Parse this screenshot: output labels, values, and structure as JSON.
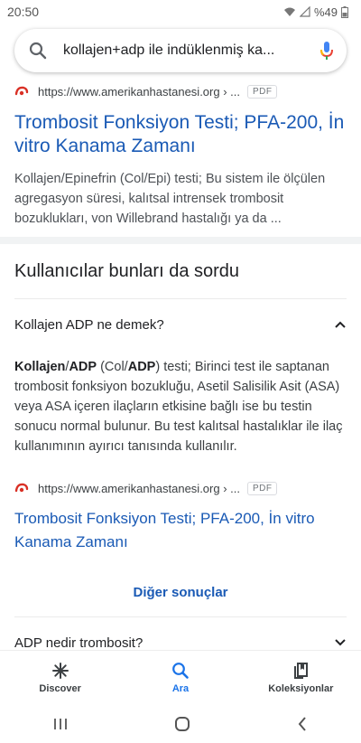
{
  "status_bar": {
    "time": "20:50",
    "battery": "%49",
    "signal": "wifi-icon signal-icon"
  },
  "search": {
    "query": "kollajen+adp ile indüklenmiş ka..."
  },
  "result1": {
    "url": "https://www.amerikanhastanesi.org › ...",
    "badge": "PDF",
    "title": "Trombosit Fonksiyon Testi; PFA-200, İn vitro Kanama Zamanı",
    "snippet": "Kollajen/Epinefrin (Col/Epi) testi; Bu sistem ile ölçülen agregasyon süresi, kalıtsal intrensek trombosit bozuklukları, von Willebrand hastalığı ya da ..."
  },
  "paa": {
    "heading": "Kullanıcılar bunları da sordu",
    "q1": "Kollajen ADP ne demek?",
    "answer": {
      "b1": "Kollajen",
      "t1": "/",
      "b2": "ADP",
      "t2": " (Col/",
      "b3": "ADP",
      "t3": ") testi; Birinci test ile saptanan trombosit fonksiyon bozukluğu, Asetil Salisilik Asit (ASA) veya ASA içeren ilaçların etkisine bağlı ise bu testin sonucu normal bulunur. Bu test kalıtsal hastalıklar ile ilaç kullanımının ayırıcı tanısında kullanılır."
    },
    "answer_source": {
      "url": "https://www.amerikanhastanesi.org › ...",
      "badge": "PDF",
      "title": "Trombosit Fonksiyon Testi; PFA-200, İn vitro Kanama Zamanı"
    },
    "more_results": "Diğer sonuçlar",
    "q2": "ADP nedir trombosit?"
  },
  "bottom_nav": {
    "items": [
      {
        "label": "Discover",
        "icon": "asterisk-icon"
      },
      {
        "label": "Ara",
        "icon": "search-icon"
      },
      {
        "label": "Koleksiyonlar",
        "icon": "collections-icon"
      }
    ]
  },
  "colors": {
    "link": "#1a5ab5",
    "accent": "#1a73e8",
    "favicon": "#d93025"
  }
}
